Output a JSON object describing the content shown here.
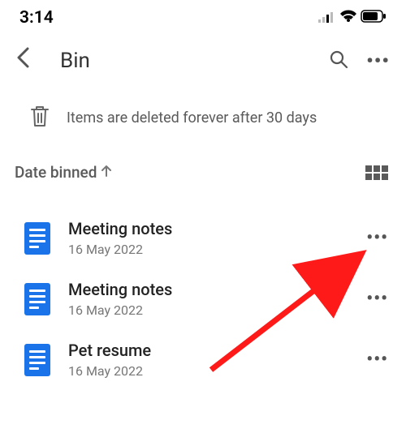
{
  "status": {
    "time": "3:14"
  },
  "nav": {
    "title": "Bin"
  },
  "banner": {
    "text": "Items are deleted forever after 30 days"
  },
  "sort": {
    "label": "Date binned"
  },
  "files": [
    {
      "name": "Meeting notes",
      "date": "16 May 2022"
    },
    {
      "name": "Meeting notes",
      "date": "16 May 2022"
    },
    {
      "name": "Pet resume",
      "date": "16 May 2022"
    }
  ]
}
